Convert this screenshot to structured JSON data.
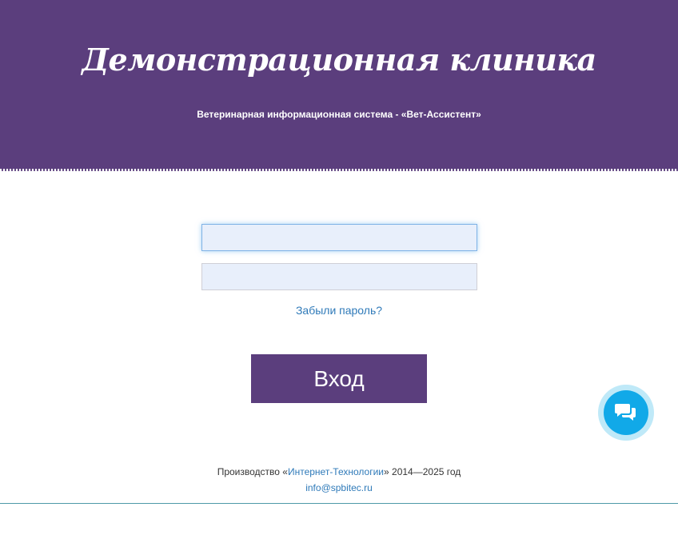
{
  "header": {
    "title": "Демонстрационная клиника",
    "subtitle": "Ветеринарная информационная система - «Вет-Ассистент»"
  },
  "form": {
    "login_value": "",
    "password_value": "",
    "forgot_label": "Забыли пароль?",
    "submit_label": "Вход"
  },
  "chat": {
    "icon": "chat-bubbles-icon"
  },
  "footer": {
    "prefix": "Производство «",
    "company": "Интернет-Технологии",
    "suffix": "» 2014—2025 год",
    "email": "info@spbitec.ru"
  },
  "colors": {
    "brand": "#5b3e7d",
    "link": "#2f7ab9",
    "chat": "#11a9e8"
  }
}
